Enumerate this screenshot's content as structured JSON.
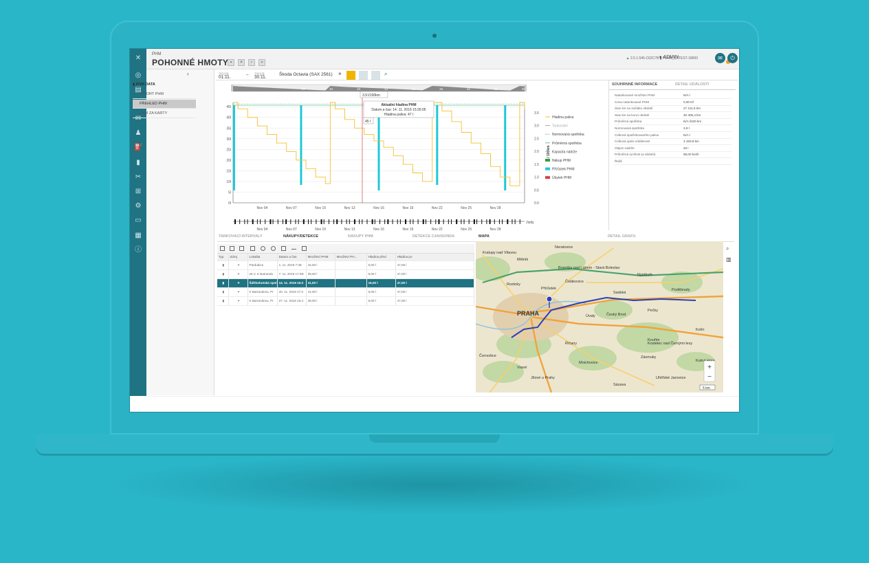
{
  "app": {
    "section_small": "PHM",
    "title": "POHONNÉ HMOTY",
    "user": "ADMIN",
    "version": "2.5.1.545-C62C7B",
    "server": "PLNW_LATEST-18000"
  },
  "sidebar": {
    "header": "PHM DATA",
    "items": [
      {
        "label": "IMPORT PHM",
        "active": false
      },
      {
        "label": "PŘEHLED PHM",
        "active": true
      },
      {
        "label": "PHM ZA KARTY",
        "active": false
      }
    ]
  },
  "toolbar": {
    "date_from": "01.11.",
    "date_from_year": "2019",
    "arrow": "→",
    "date_to": "30.11.",
    "date_to_year": "2019",
    "vehicle": "Škoda Octavia (SAX 2561)",
    "clear": "×"
  },
  "chart_data": {
    "type": "line",
    "x_ticks": [
      "Nov 04",
      "Nov 07",
      "Nov 10",
      "Nov 13",
      "Nov 16",
      "Nov 19",
      "Nov 22",
      "Nov 25",
      "Nov 28"
    ],
    "y_left_ticks": [
      "0l",
      "5l",
      "10l",
      "15l",
      "20l",
      "25l",
      "30l",
      "35l",
      "40l",
      "45l"
    ],
    "y_left_range": [
      0,
      47
    ],
    "y_right_ticks": [
      "0.0",
      "0.5",
      "1.0",
      "1.5",
      "2.0",
      "2.5",
      "3.0",
      "3.5"
    ],
    "y_right_label": "l / 100km",
    "y_right_range": [
      0,
      3.9
    ],
    "series": [
      {
        "name": "Hladina paliva",
        "color": "#f2c12e",
        "x": [
          0,
          0.5,
          1.5,
          2.5,
          3.5,
          4.5,
          5.5,
          6.5,
          7.5,
          8.5,
          9.5,
          10,
          10.5,
          11.5,
          12.5,
          13.5,
          14.5,
          15.5,
          16.5,
          17.5,
          18.5,
          19.5,
          20.5,
          21.5,
          22.5,
          23.5,
          24.5,
          25.5,
          26.5,
          27.5,
          28.5,
          29.5,
          30
        ],
        "values": [
          47,
          44,
          40,
          36,
          32,
          28,
          24,
          20,
          16,
          12,
          9,
          47,
          44,
          39,
          35,
          32,
          29,
          26,
          22,
          18,
          14,
          10,
          47,
          43,
          38,
          33,
          28,
          23,
          17,
          12,
          8,
          47,
          44
        ]
      },
      {
        "name": "Tankování",
        "color": "#aaaaaa",
        "values": []
      },
      {
        "name": "Normovaná spotřeba",
        "color": "#8ab4c8",
        "values": []
      },
      {
        "name": "Průměrná spotřeba",
        "color": "#6ac38f",
        "values": [
          3.5
        ]
      },
      {
        "name": "Kapacita nádrže",
        "color": "#9acfa7",
        "values": [
          47
        ]
      },
      {
        "name": "Nákup PHM",
        "color": "#2e9e3e",
        "values": []
      },
      {
        "name": "Přírůstek PHM",
        "color": "#1fc7d8",
        "values": []
      },
      {
        "name": "Úbytek PHM",
        "color": "#d64040",
        "values": []
      }
    ],
    "refuel_days": [
      0,
      7,
      15,
      21,
      28
    ],
    "marker_day": 13.3,
    "tooltip": {
      "title": "Aktuální hladina PHM",
      "line1": "Datum a čas: 14. 11. 2019 15:26:05",
      "line2": "Hladina paliva: 47 l",
      "value": "45 l",
      "top_value": "3.9 l/100km"
    },
    "trips_label": "Jízdy",
    "navigator_labels": [
      "07",
      "10",
      "10",
      "13",
      "16",
      "19",
      "22",
      "25",
      "28"
    ]
  },
  "info": {
    "tabs": [
      "SOUHRNNÉ INFORMACE",
      "DETAIL UDÁLOSTI"
    ],
    "rows": [
      {
        "k": "Natankované množství PHM",
        "v": "N/A l"
      },
      {
        "k": "Cena natankované PHM",
        "v": "0,00 Kč"
      },
      {
        "k": "Stav km na začátku období",
        "v": "27 211,5 km"
      },
      {
        "k": "Stav km na konci období",
        "v": "30 405,4 km"
      },
      {
        "k": "Průměrná spotřeba",
        "v": "N/A l/100 km"
      },
      {
        "k": "Normovaná spotřeba",
        "v": "3,9 l"
      },
      {
        "k": "Celková spotřebovaného paliva",
        "v": "N/A l"
      },
      {
        "k": "Celková ujetá vzdálenost",
        "v": "3 193,9 km"
      },
      {
        "k": "Objem nádrže",
        "v": "45 l"
      },
      {
        "k": "Průměrná rychlost (a období)",
        "v": "58,00 km/h"
      },
      {
        "k": "Řidiči",
        "v": ""
      }
    ]
  },
  "bottom_tabs": [
    "TANKOVACÍ INTERVALY",
    "NÁKUPY/DETEKCE",
    "NÁKUPY PHM",
    "DETEKCE CAN/SONDA"
  ],
  "right_tabs": [
    "MAPA",
    "DETAIL GRAFU"
  ],
  "grid": {
    "columns": [
      "Typ",
      "Zdroj",
      "Lokalita",
      "Datum a čas",
      "Množství PHM",
      "Množství PH...",
      "Hladina před",
      "Hladina po"
    ],
    "rows": [
      {
        "lok": "Pardubice",
        "dt": "1. 11. 2019 7:39:",
        "m1": "42,00 l",
        "m2": "",
        "hp": "5,00 l",
        "ho": "47,00 l",
        "sel": false
      },
      {
        "lok": "str.V, K Barrando",
        "dt": "7. 11. 2019 17:08:",
        "m1": "38,00 l",
        "m2": "",
        "hp": "9,00 l",
        "ho": "47,00 l",
        "sel": false
      },
      {
        "lok": "Šáfrbohotská spol",
        "dt": "14. 11. 2019 15:2",
        "m1": "31,00 l",
        "m2": "",
        "hp": "16,00 l",
        "ho": "47,00 l",
        "sel": true
      },
      {
        "lok": "K Barrandovu, Pr",
        "dt": "20. 11. 2019 17:2",
        "m1": "41,00 l",
        "m2": "",
        "hp": "6,00 l",
        "ho": "47,00 l",
        "sel": false
      },
      {
        "lok": "K Barrandovu, Pr",
        "dt": "27. 11. 2019 16:4",
        "m1": "39,00 l",
        "m2": "",
        "hp": "8,00 l",
        "ho": "47,00 l",
        "sel": false
      }
    ]
  },
  "map": {
    "labels": [
      "Neratovice",
      "Kralupy nad Vltavou",
      "Brandýs nad Labem - Stará Boleslav",
      "Mělník",
      "Roztoky",
      "Čelákovice",
      "Nymburk",
      "Poděbrady",
      "Sadská",
      "PRAHA",
      "Úvaly",
      "Český Brod",
      "Pečky",
      "Kolín",
      "Říčany",
      "Kostelec nad Černými lesy",
      "Kouřim",
      "Zásmuky",
      "Černošice",
      "Mnichovice",
      "Jílové u Prahy",
      "Sázava",
      "Uhlířské Janovice",
      "Kutná Hora",
      "Přírůstek",
      "Vrané"
    ],
    "scale": "5 km",
    "zoom_in": "+",
    "zoom_out": "−"
  }
}
